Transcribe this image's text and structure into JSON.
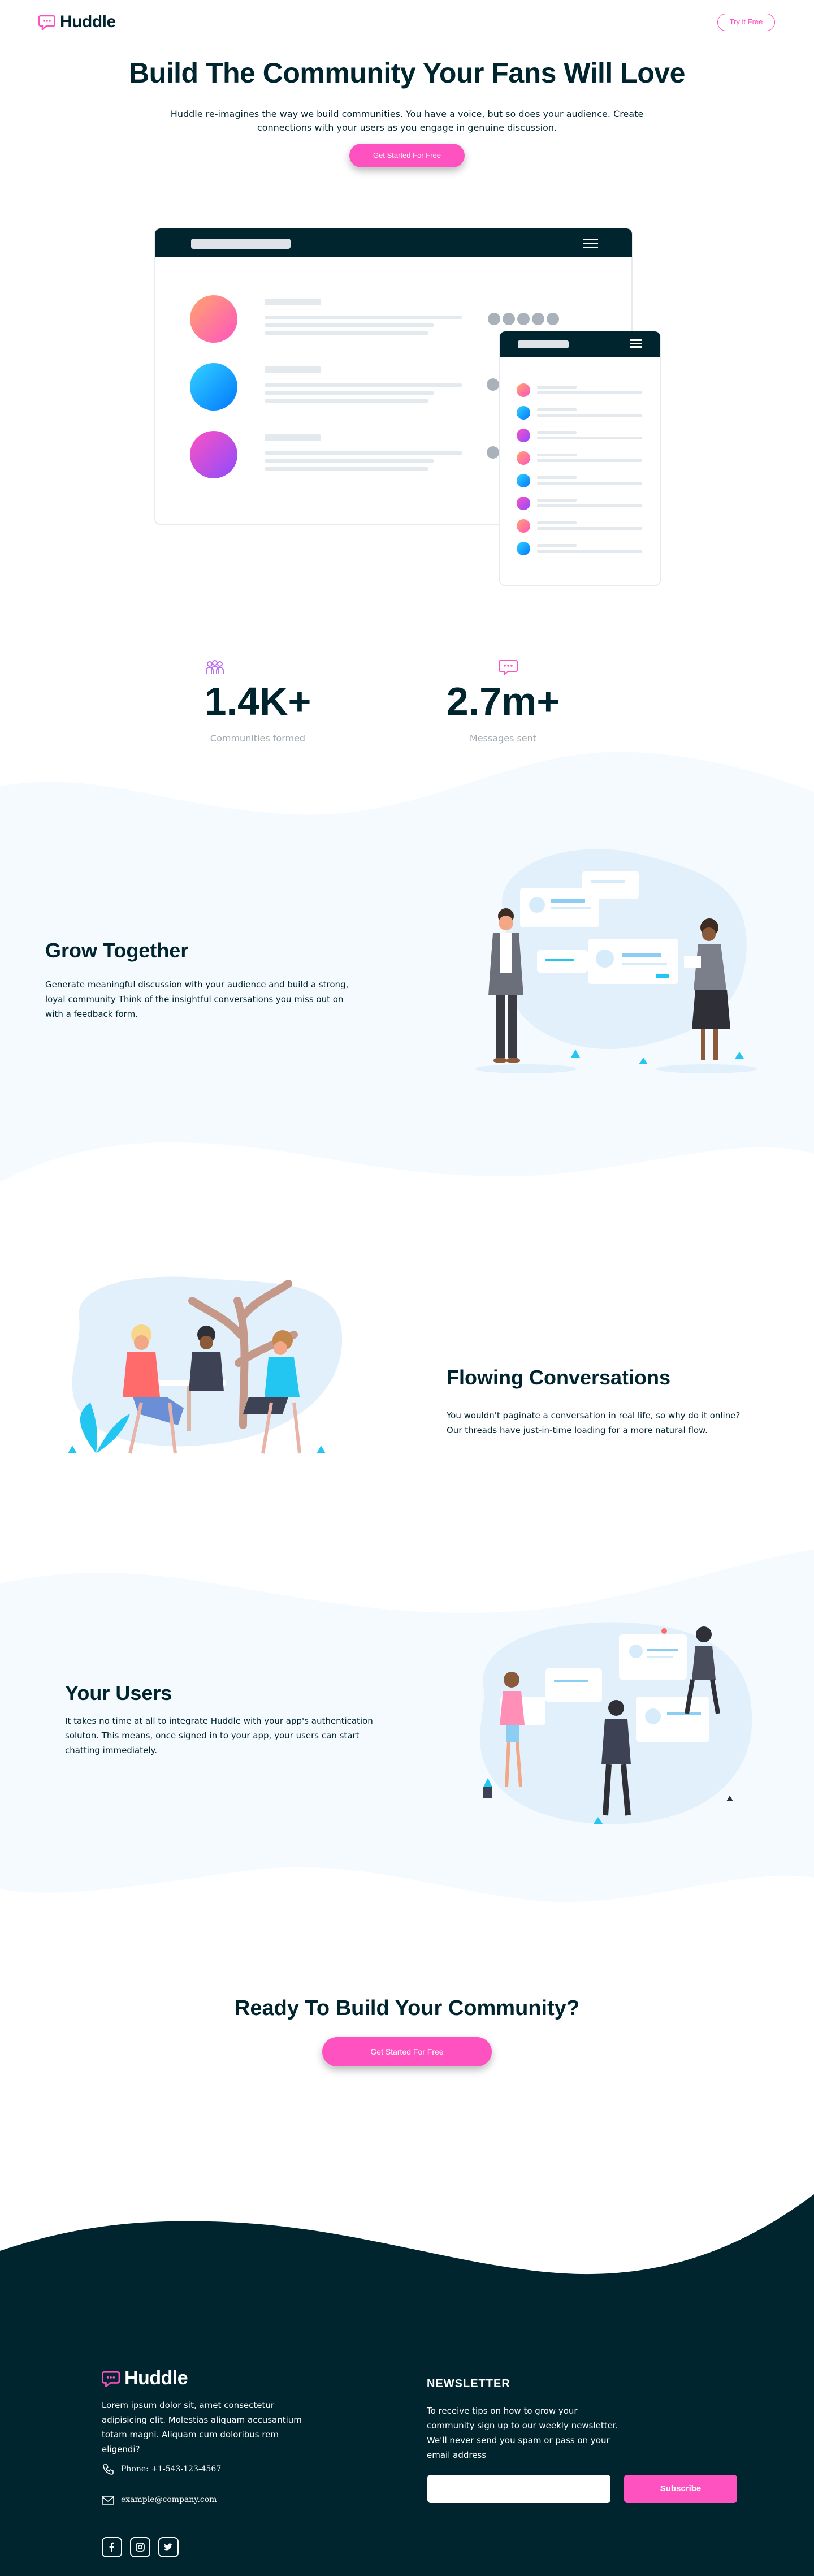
{
  "header": {
    "brand": "Huddle",
    "try_button": "Try it Free"
  },
  "hero": {
    "title": "Build The Community Your Fans Will Love",
    "subtitle_line1": "Huddle re-imagines the way we build communities. You have a voice, but so does your audience. Create",
    "subtitle_line2": "connections with your users as you engage in genuine discussion.",
    "cta": "Get Started For Free"
  },
  "stats": [
    {
      "value": "1.4K+",
      "label": "Communities formed",
      "icon": "communities-icon"
    },
    {
      "value": "2.7m+",
      "label": "Messages sent",
      "icon": "messages-icon"
    }
  ],
  "features": [
    {
      "title": "Grow Together",
      "text": "Generate meaningful discussion with your audience and build a strong, loyal community Think of the insightful conversations you miss out on with a feedback form."
    },
    {
      "title": "Flowing Conversations",
      "text": "You wouldn't paginate a conversation in real life, so why do it online? Our threads have just-in-time loading for a more natural flow."
    },
    {
      "title": "Your Users",
      "text": "It takes no time at all to integrate Huddle with your app's authentication soluton. This means, once signed in to your app, your users can start chatting immediately."
    }
  ],
  "cta": {
    "title": "Ready To Build Your Community?",
    "button": "Get Started For Free"
  },
  "footer": {
    "brand": "Huddle",
    "about": "Lorem ipsum dolor sit, amet consectetur adipisicing elit. Molestias aliquam accusantium totam magni. Aliquam cum doloribus rem eligendi?",
    "phone": "Phone: +1-543-123-4567",
    "email": "example@company.com",
    "newsletter_title": "NEWSLETTER",
    "newsletter_text": "To receive tips on how to grow your community sign up to our weekly newsletter. We'll never send you spam or pass on your email address",
    "email_placeholder": "",
    "subscribe": "Subscribe"
  },
  "colors": {
    "primary_dark": "#00252e",
    "pink": "#ff52c1",
    "light_blue_bg": "#f5faff"
  }
}
